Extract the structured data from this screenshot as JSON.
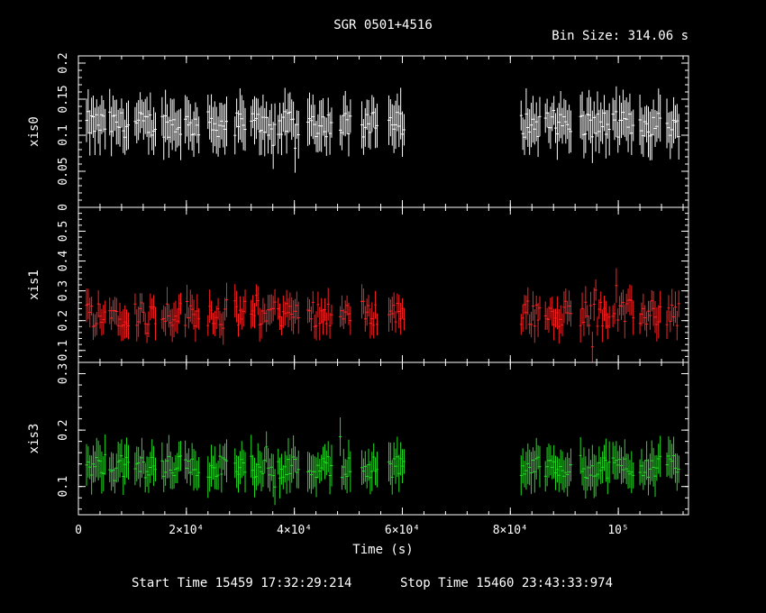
{
  "title": "SGR 0501+4516",
  "bin_size_label": "Bin Size: 314.06 s",
  "start_time_label": "Start Time 15459 17:32:29:214",
  "stop_time_label": "Stop Time 15460 23:43:33:974",
  "colors": {
    "xis0": "#ffffff",
    "xis1": "#ff2020",
    "xis3": "#22dd22",
    "axes": "#ffffff",
    "background": "#000000"
  },
  "chart_data": {
    "type": "scatter",
    "xlabel": "Time (s)",
    "xlim": [
      0,
      113000
    ],
    "x_ticks": [
      {
        "value": 0,
        "label": "0"
      },
      {
        "value": 20000,
        "label": "2×10⁴"
      },
      {
        "value": 40000,
        "label": "4×10⁴"
      },
      {
        "value": 60000,
        "label": "6×10⁴"
      },
      {
        "value": 80000,
        "label": "8×10⁴"
      },
      {
        "value": 100000,
        "label": "10⁵"
      }
    ],
    "grid": false,
    "segments": [
      [
        1500,
        5000
      ],
      [
        5800,
        9500
      ],
      [
        10500,
        14500
      ],
      [
        15500,
        19000
      ],
      [
        19800,
        22500
      ],
      [
        24000,
        27500
      ],
      [
        29000,
        31000
      ],
      [
        32000,
        36500
      ],
      [
        37000,
        41000
      ],
      [
        42500,
        47000
      ],
      [
        48500,
        50500
      ],
      [
        52500,
        55500
      ],
      [
        57500,
        60500
      ],
      [
        82000,
        85500
      ],
      [
        86500,
        91500
      ],
      [
        93000,
        98500
      ],
      [
        99000,
        103000
      ],
      [
        104000,
        108000
      ],
      [
        109000,
        111500
      ]
    ],
    "panels": [
      {
        "name": "xis0",
        "ylabel": "xis0",
        "ylim": [
          0,
          0.21
        ],
        "ticks": [
          0,
          0.05,
          0.1,
          0.15,
          0.2
        ],
        "tick_labels": [
          "0",
          "0.05",
          "0.1",
          "0.15",
          "0.2"
        ],
        "level": 0.115,
        "noise": 0.018,
        "err": 0.028,
        "color": "#ffffff"
      },
      {
        "name": "xis1",
        "ylabel": "xis1",
        "ylim": [
          0.06,
          0.58
        ],
        "ticks": [
          0.1,
          0.2,
          0.3,
          0.4,
          0.5
        ],
        "tick_labels": [
          "0.1",
          "0.2",
          "0.3",
          "0.4",
          "0.5"
        ],
        "level": 0.225,
        "noise": 0.045,
        "err": 0.045,
        "color": "#ff2020"
      },
      {
        "name": "xis3",
        "ylabel": "xis3",
        "ylim": [
          0.05,
          0.32
        ],
        "ticks": [
          0.1,
          0.2,
          0.3
        ],
        "tick_labels": [
          "0.1",
          "0.2",
          "0.3"
        ],
        "level": 0.135,
        "noise": 0.02,
        "err": 0.03,
        "color": "#22dd22"
      }
    ]
  }
}
